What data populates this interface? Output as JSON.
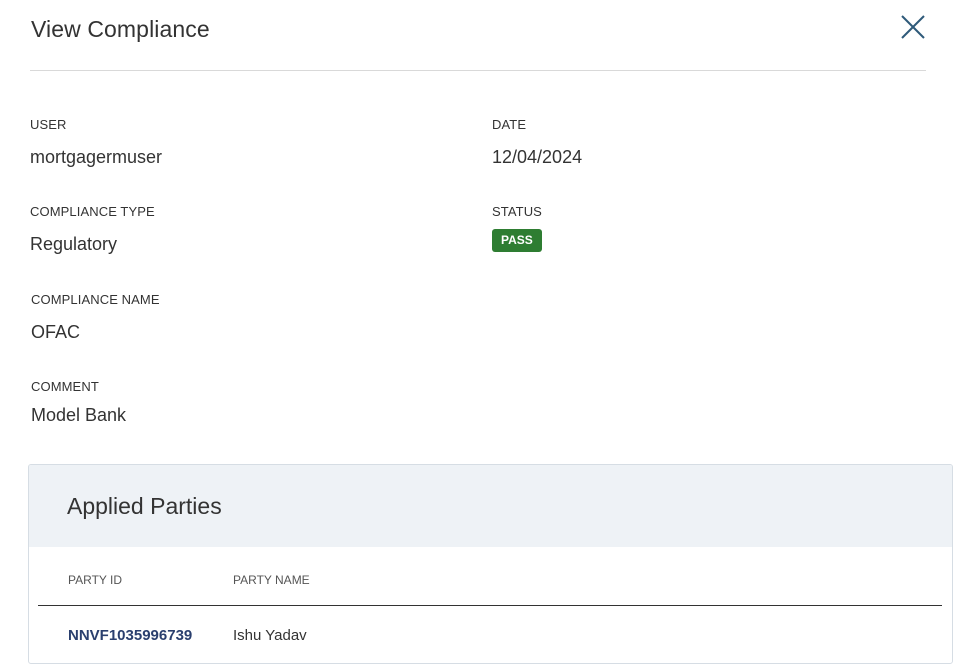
{
  "dialog": {
    "title": "View Compliance"
  },
  "fields": {
    "user": {
      "label": "USER",
      "value": "mortgagermuser"
    },
    "date": {
      "label": "DATE",
      "value": "12/04/2024"
    },
    "compliance_type": {
      "label": "COMPLIANCE TYPE",
      "value": "Regulatory"
    },
    "status": {
      "label": "STATUS",
      "value": "PASS",
      "color": "#2e7d32"
    },
    "compliance_name": {
      "label": "COMPLIANCE NAME",
      "value": "OFAC"
    },
    "comment": {
      "label": "COMMENT",
      "value": "Model Bank"
    }
  },
  "applied_parties": {
    "title": "Applied Parties",
    "columns": [
      "PARTY ID",
      "PARTY NAME"
    ],
    "rows": [
      {
        "party_id": "NNVF1035996739",
        "party_name": "Ishu Yadav"
      }
    ]
  },
  "icons": {
    "close": "close-icon"
  }
}
